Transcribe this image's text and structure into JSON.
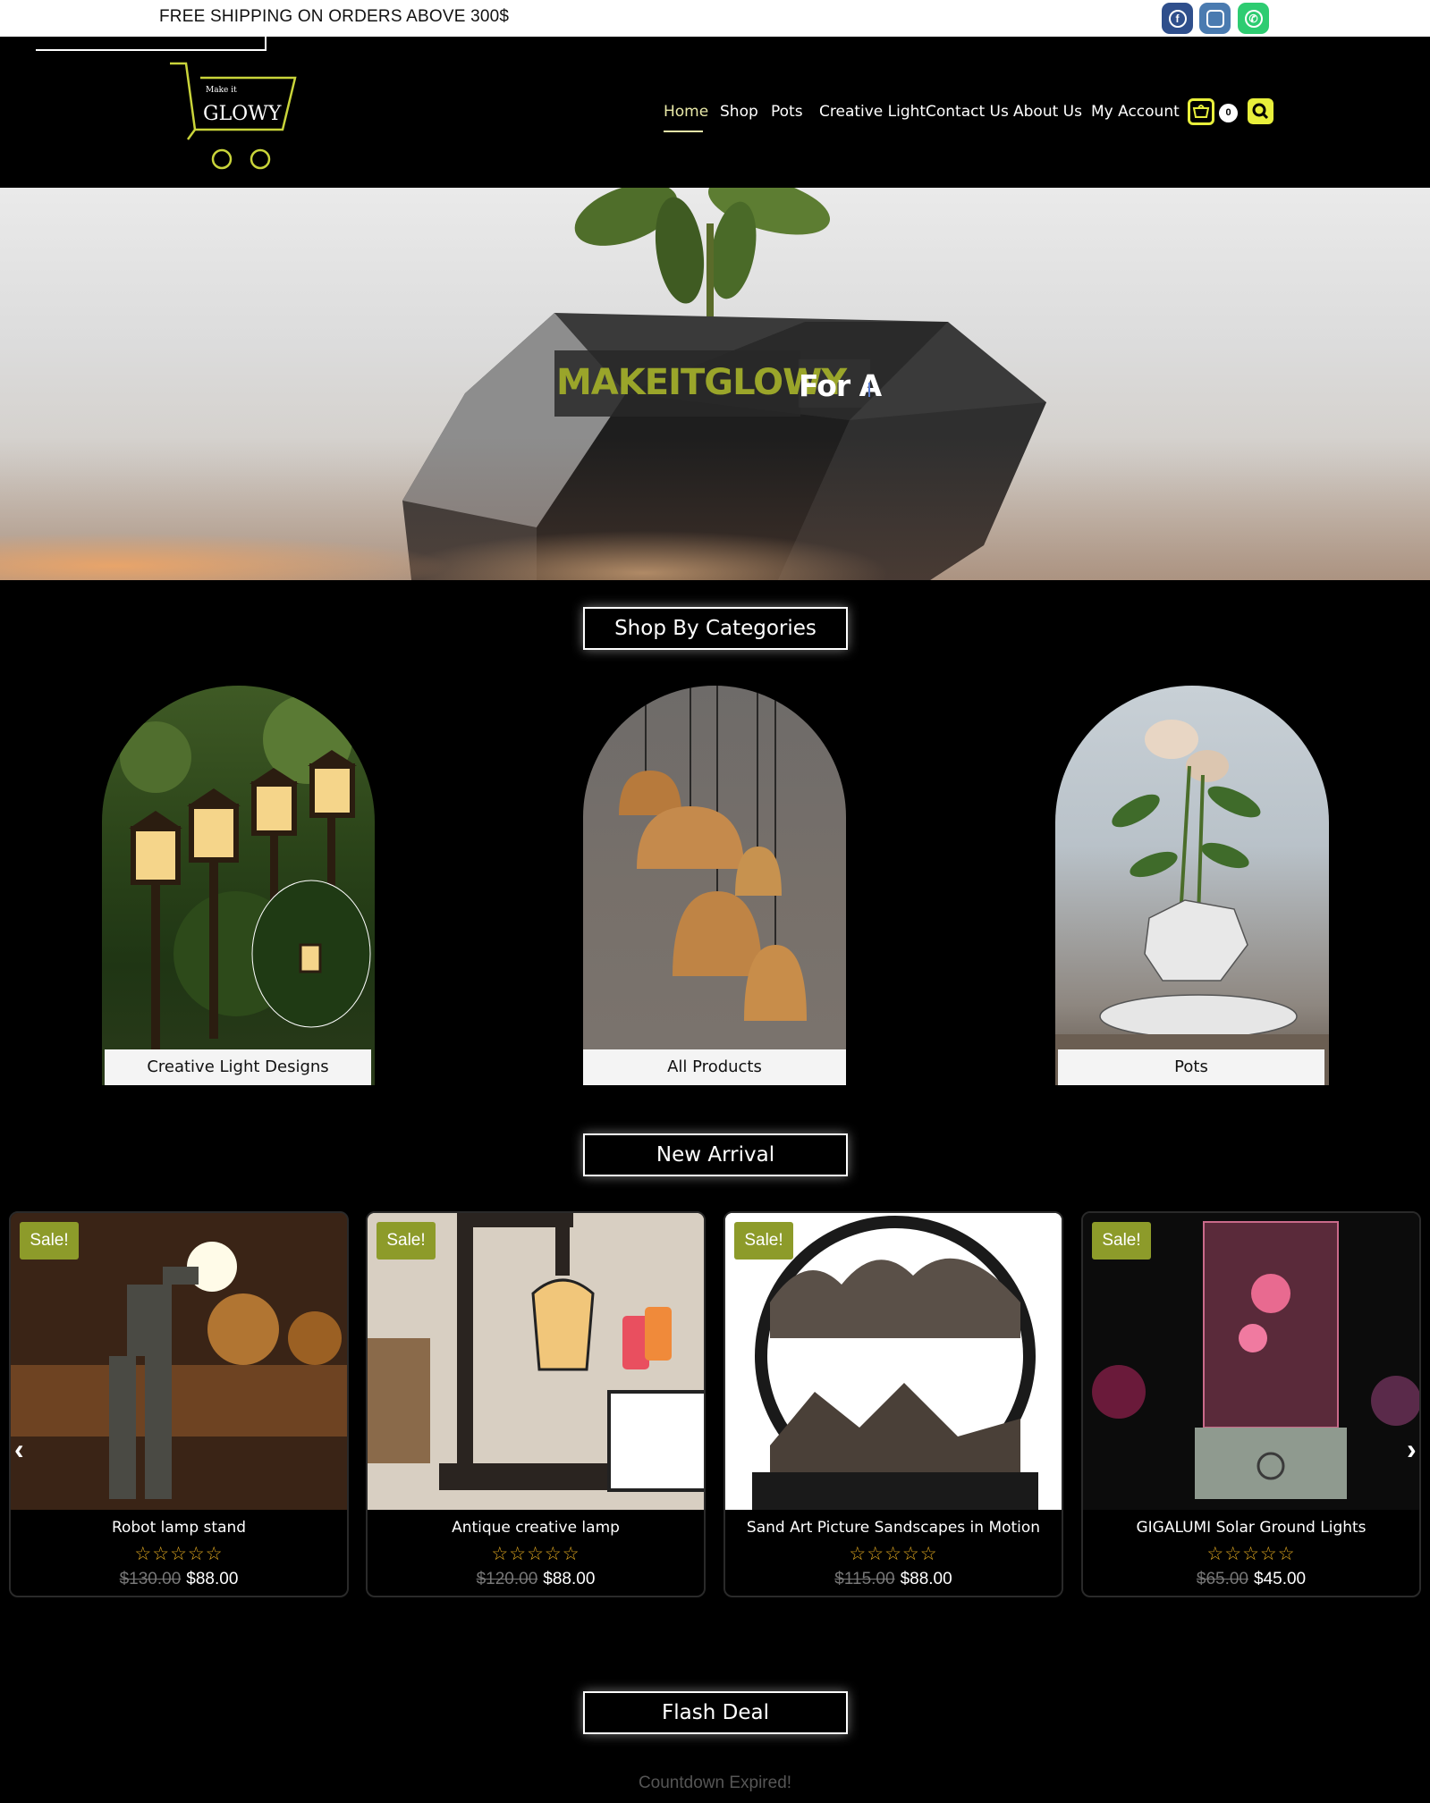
{
  "topbar": {
    "promo": "FREE SHIPPING  ON ORDERS ABOVE 300$",
    "social": [
      {
        "icon": "facebook-icon",
        "glyph": "f"
      },
      {
        "icon": "instagram-icon",
        "glyph": "◎"
      },
      {
        "icon": "whatsapp-icon",
        "glyph": "✆"
      }
    ]
  },
  "header": {
    "logo_small": "Make it",
    "logo_text": "GLOWY",
    "nav": [
      "Home",
      "Shop",
      "Pots",
      "Creative Light",
      "Contact Us",
      "About Us",
      "My Account"
    ],
    "cart_count": "0",
    "accent": "#e8ef3b"
  },
  "hero": {
    "title": "MAKEITGLOWY",
    "subtitle": "For A"
  },
  "categories": {
    "title": "Shop By Categories",
    "items": [
      "Creative Light Designs",
      "All Products",
      "Pots"
    ]
  },
  "new_arrival": {
    "title": "New Arrival",
    "products": [
      {
        "sale": "Sale!",
        "name": "Robot lamp stand",
        "stars": "☆☆☆☆☆",
        "old_price": "$130.00",
        "price": "$88.00"
      },
      {
        "sale": "Sale!",
        "name": "Antique creative lamp",
        "stars": "☆☆☆☆☆",
        "old_price": "$120.00",
        "price": "$88.00"
      },
      {
        "sale": "Sale!",
        "name": "Sand Art Picture Sandscapes in Motion",
        "stars": "☆☆☆☆☆",
        "old_price": "$115.00",
        "price": "$88.00"
      },
      {
        "sale": "Sale!",
        "name": "GIGALUMI Solar Ground Lights",
        "stars": "☆☆☆☆☆",
        "old_price": "$65.00",
        "price": "$45.00"
      }
    ]
  },
  "flash_deal": {
    "title": "Flash Deal",
    "countdown": "Countdown Expired!"
  },
  "arrows": {
    "prev": "‹",
    "next": "›"
  }
}
